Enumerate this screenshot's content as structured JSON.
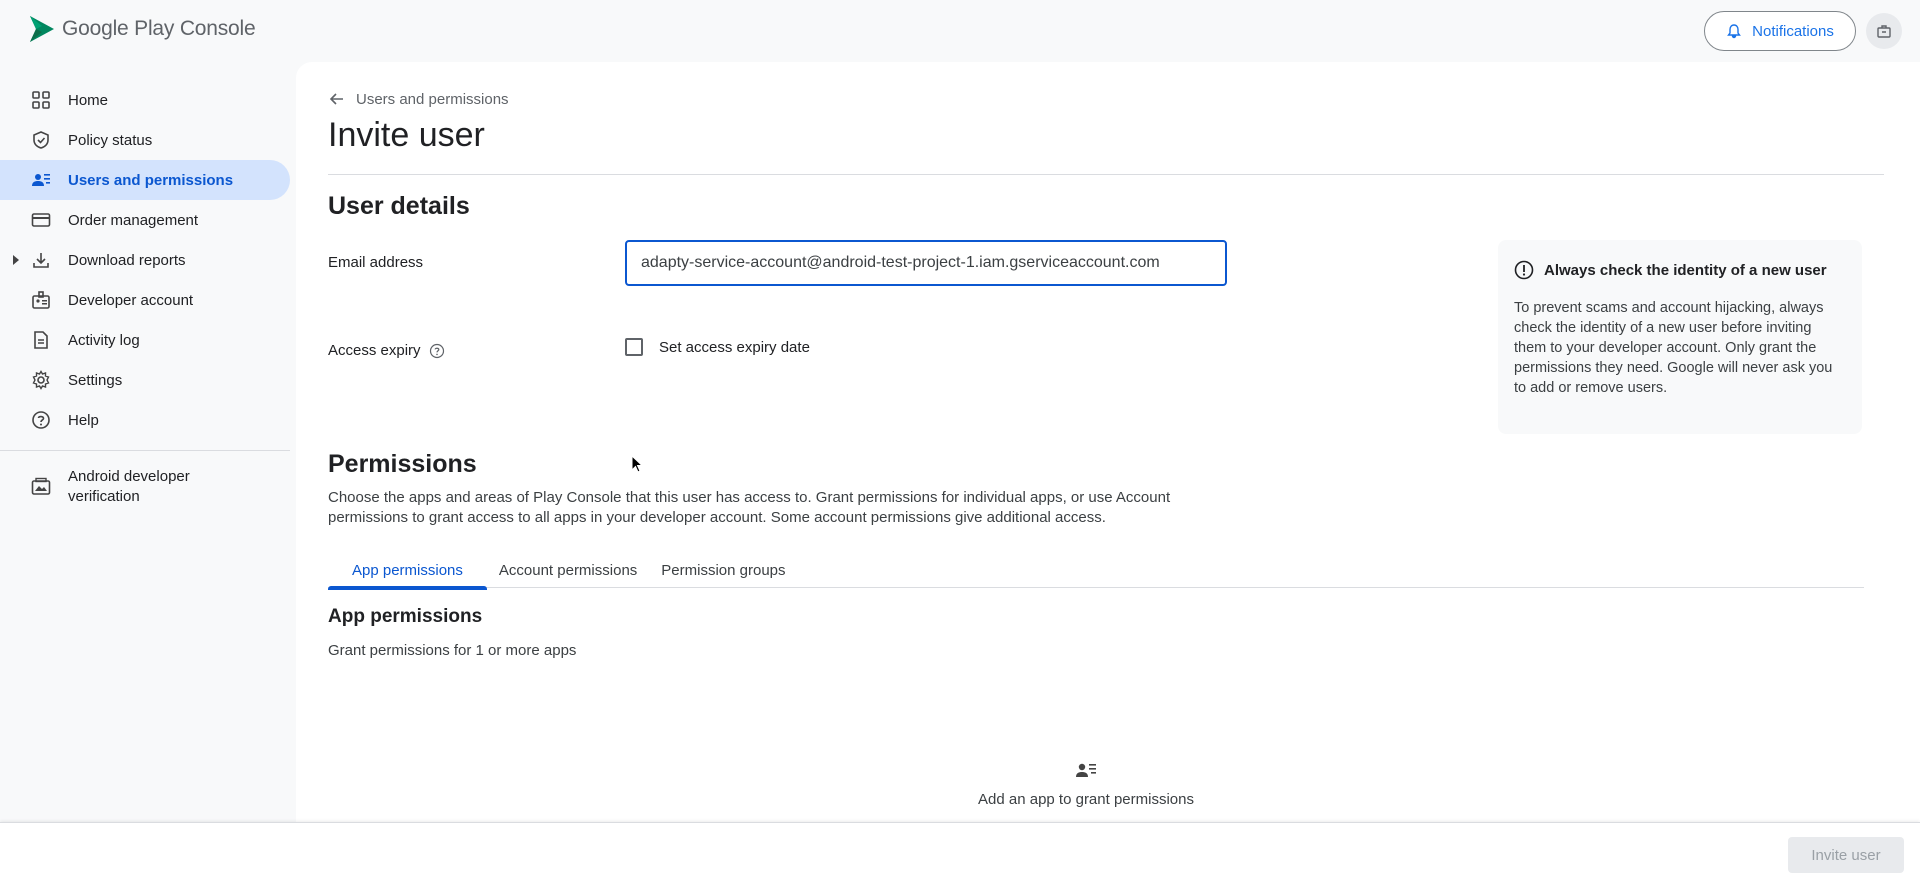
{
  "header": {
    "logo_text": "Google Play Console",
    "notifications_label": "Notifications",
    "brand_color": "#01875f"
  },
  "sidebar": {
    "items": [
      {
        "label": "Home",
        "icon": "dashboard-grid-icon",
        "active": false
      },
      {
        "label": "Policy status",
        "icon": "shield-check-icon",
        "active": false
      },
      {
        "label": "Users and permissions",
        "icon": "manage-accounts-icon",
        "active": true
      },
      {
        "label": "Order management",
        "icon": "credit-card-icon",
        "active": false
      },
      {
        "label": "Download reports",
        "icon": "download-icon",
        "active": false,
        "expandable": true
      },
      {
        "label": "Developer account",
        "icon": "badge-icon",
        "active": false
      },
      {
        "label": "Activity log",
        "icon": "document-icon",
        "active": false
      },
      {
        "label": "Settings",
        "icon": "gear-icon",
        "active": false
      },
      {
        "label": "Help",
        "icon": "help-icon",
        "active": false
      }
    ],
    "extra_item": {
      "label": "Android developer verification",
      "icon": "id-card-icon"
    }
  },
  "breadcrumb": {
    "label": "Users and permissions"
  },
  "page": {
    "title": "Invite user"
  },
  "user_details": {
    "title": "User details",
    "email_label": "Email address",
    "email_value": "adapty-service-account@android-test-project-1.iam.gserviceaccount.com",
    "expiry_label": "Access expiry",
    "expiry_checkbox_label": "Set access expiry date"
  },
  "info_card": {
    "title": "Always check the identity of a new user",
    "body": "To prevent scams and account hijacking, always check the identity of a new user before inviting them to your developer account. Only grant the permissions they need. Google will never ask you to add or remove users."
  },
  "permissions": {
    "title": "Permissions",
    "description": "Choose the apps and areas of Play Console that this user has access to. Grant permissions for individual apps, or use Account permissions to grant access to all apps in your developer account. Some account permissions give additional access.",
    "tabs": [
      {
        "label": "App permissions",
        "active": true
      },
      {
        "label": "Account permissions",
        "active": false
      },
      {
        "label": "Permission groups",
        "active": false
      }
    ],
    "app_title": "App permissions",
    "app_desc": "Grant permissions for 1 or more apps",
    "empty_text": "Add an app to grant permissions"
  },
  "footer": {
    "invite_label": "Invite user"
  },
  "colors": {
    "accent": "#0b57d0",
    "active_bg": "#d3e3fd"
  }
}
